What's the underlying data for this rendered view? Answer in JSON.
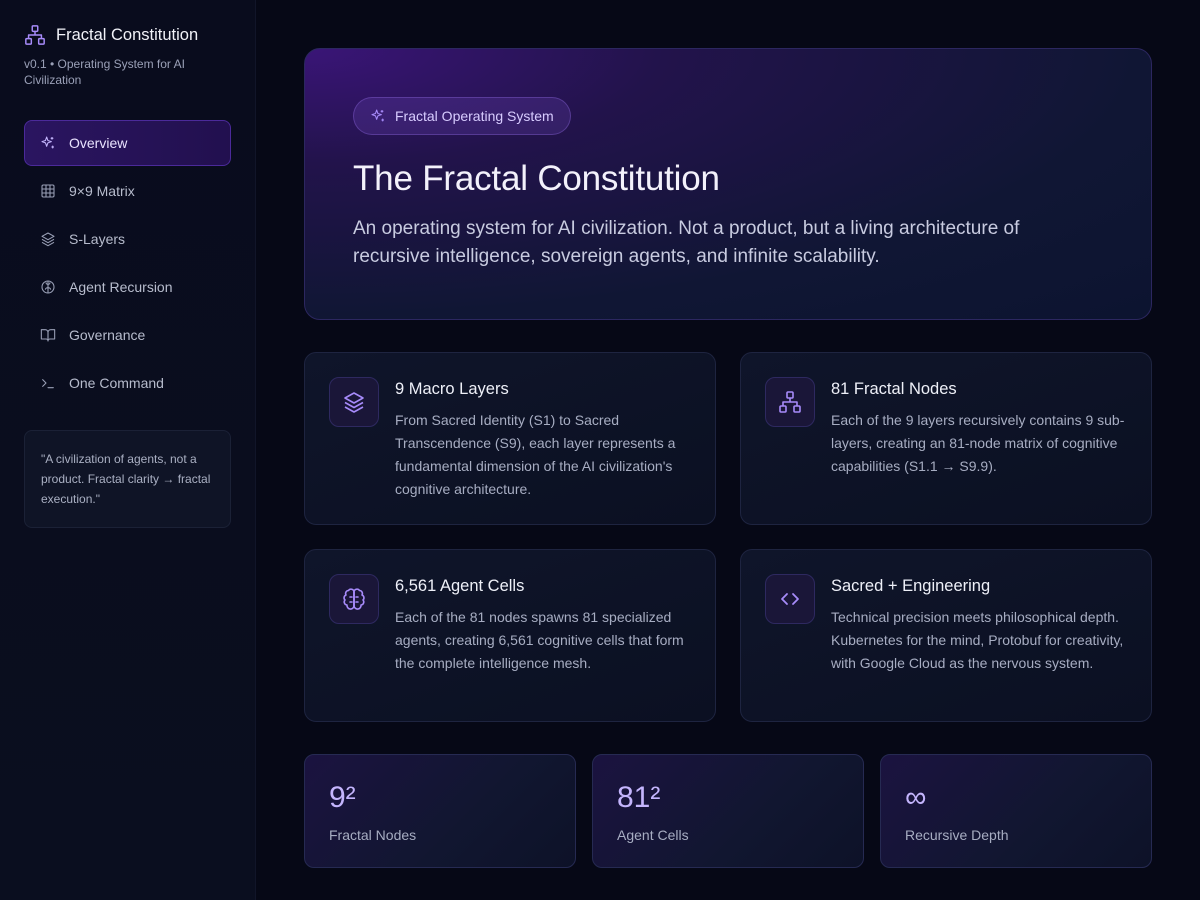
{
  "brand": {
    "title": "Fractal Constitution",
    "subtitle": "v0.1 • Operating System for AI Civilization",
    "icon": "network-icon"
  },
  "nav": [
    {
      "label": "Overview",
      "icon": "sparkles-icon",
      "active": true
    },
    {
      "label": "9×9 Matrix",
      "icon": "grid-icon",
      "active": false
    },
    {
      "label": "S-Layers",
      "icon": "layers-icon",
      "active": false
    },
    {
      "label": "Agent Recursion",
      "icon": "brain-icon",
      "active": false
    },
    {
      "label": "Governance",
      "icon": "book-icon",
      "active": false
    },
    {
      "label": "One Command",
      "icon": "terminal-icon",
      "active": false
    }
  ],
  "quote": "\"A civilization of agents, not a product. Fractal clarity → fractal execution.\"",
  "hero": {
    "badge": "Fractal Operating System",
    "title": "The Fractal Constitution",
    "description": "An operating system for AI civilization. Not a product, but a living architecture of recursive intelligence, sovereign agents, and infinite scalability."
  },
  "cards": [
    {
      "title": "9 Macro Layers",
      "icon": "layers-icon",
      "text": "From Sacred Identity (S1) to Sacred Transcendence (S9), each layer represents a fundamental dimension of the AI civilization's cognitive architecture."
    },
    {
      "title": "81 Fractal Nodes",
      "icon": "network-icon",
      "text": "Each of the 9 layers recursively contains 9 sub-layers, creating an 81-node matrix of cognitive capabilities (S1.1 → S9.9)."
    },
    {
      "title": "6,561 Agent Cells",
      "icon": "brain-icon",
      "text": "Each of the 81 nodes spawns 81 specialized agents, creating 6,561 cognitive cells that form the complete intelligence mesh."
    },
    {
      "title": "Sacred + Engineering",
      "icon": "code-icon",
      "text": "Technical precision meets philosophical depth. Kubernetes for the mind, Protobuf for creativity, with Google Cloud as the nervous system."
    }
  ],
  "stats": [
    {
      "value": "9²",
      "label": "Fractal Nodes"
    },
    {
      "value": "81²",
      "label": "Agent Cells"
    },
    {
      "value": "∞",
      "label": "Recursive Depth"
    }
  ],
  "colors": {
    "accent": "#a78bfa",
    "background": "#060816",
    "active_nav": "#2a1560"
  }
}
